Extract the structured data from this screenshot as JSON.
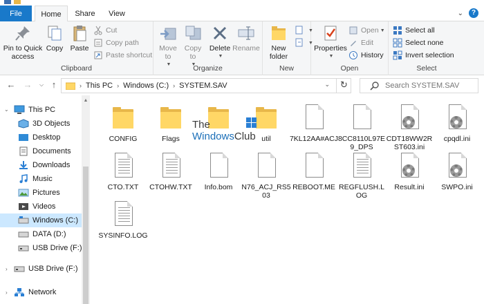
{
  "titlebar": {
    "title": "SYSTEM.SAV"
  },
  "tabs": {
    "file": "File",
    "home": "Home",
    "share": "Share",
    "view": "View"
  },
  "ribbon": {
    "clipboard": {
      "label": "Clipboard",
      "pin": "Pin to Quick access",
      "copy": "Copy",
      "paste": "Paste",
      "cut": "Cut",
      "copy_path": "Copy path",
      "paste_shortcut": "Paste shortcut"
    },
    "organize": {
      "label": "Organize",
      "move_to": "Move to",
      "copy_to": "Copy to",
      "delete": "Delete",
      "rename": "Rename"
    },
    "new": {
      "label": "New",
      "new_folder": "New folder"
    },
    "open": {
      "label": "Open",
      "properties": "Properties",
      "open": "Open",
      "edit": "Edit",
      "history": "History"
    },
    "select": {
      "label": "Select",
      "select_all": "Select all",
      "select_none": "Select none",
      "invert": "Invert selection"
    }
  },
  "address": {
    "crumbs": [
      "This PC",
      "Windows (C:)",
      "SYSTEM.SAV"
    ]
  },
  "search": {
    "placeholder": "Search SYSTEM.SAV"
  },
  "nav": {
    "items": [
      "This PC",
      "3D Objects",
      "Desktop",
      "Documents",
      "Downloads",
      "Music",
      "Pictures",
      "Videos",
      "Windows (C:)",
      "DATA (D:)",
      "USB Drive (F:)",
      "USB Drive (F:)",
      "Network"
    ],
    "selected": "Windows (C:)"
  },
  "files": [
    {
      "name": "CONFIG",
      "type": "folder"
    },
    {
      "name": "Flags",
      "type": "folder"
    },
    {
      "name": "",
      "type": "folder"
    },
    {
      "name": "util",
      "type": "folder"
    },
    {
      "name": "7KL12AA#ACJ",
      "type": "file"
    },
    {
      "name": "8CC8110L97E9_DPS",
      "type": "file"
    },
    {
      "name": "CDT18WW2RST603.ini",
      "type": "config"
    },
    {
      "name": "cpqdl.ini",
      "type": "config"
    },
    {
      "name": "CTO.TXT",
      "type": "text"
    },
    {
      "name": "CTOHW.TXT",
      "type": "text"
    },
    {
      "name": "Info.bom",
      "type": "file"
    },
    {
      "name": "N76_ACJ_RS503",
      "type": "file"
    },
    {
      "name": "REBOOT.ME",
      "type": "file"
    },
    {
      "name": "REGFLUSH.LOG",
      "type": "text"
    },
    {
      "name": "Result.ini",
      "type": "config"
    },
    {
      "name": "SWPO.ini",
      "type": "config"
    },
    {
      "name": "SYSINFO.LOG",
      "type": "text"
    }
  ],
  "watermark": {
    "line1": "The",
    "line2a": "Windows",
    "line2b": "Club"
  },
  "colors": {
    "accent": "#1979ca",
    "selection": "#cce8ff",
    "folder": "#ffd766"
  }
}
